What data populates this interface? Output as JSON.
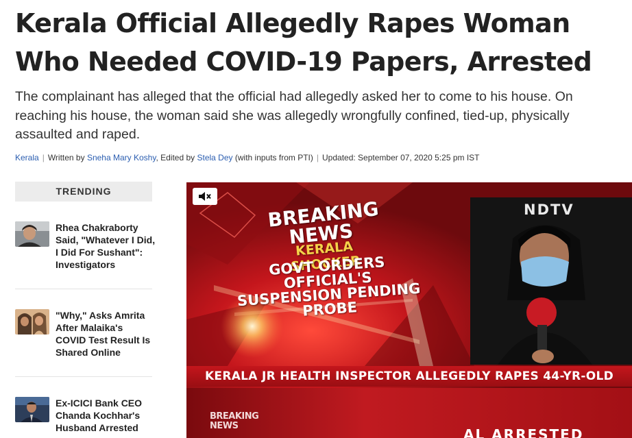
{
  "article": {
    "headline": "Kerala Official Allegedly Rapes Woman Who Needed COVID-19 Papers, Arrested",
    "summary": "The complainant has alleged that the official had allegedly asked her to come to his house. On reaching his house, the woman said she was allegedly wrongfully confined, tied-up, physically assaulted and raped.",
    "byline": {
      "category": "Kerala",
      "written_by_prefix": "Written by ",
      "author": "Sneha Mary Koshy",
      "edited_by_prefix": ", Edited by ",
      "editor": "Stela Dey",
      "inputs": " (with inputs from PTI)",
      "updated": "Updated: September 07, 2020 5:25 pm IST"
    }
  },
  "trending": {
    "header": "TRENDING",
    "items": [
      {
        "title": "Rhea Chakraborty Said, \"Whatever I Did, I Did For Sushant\": Investigators"
      },
      {
        "title": "\"Why,\" Asks Amrita After Malaika's COVID Test Result Is Shared Online"
      },
      {
        "title": "Ex-ICICI Bank CEO Chanda Kochhar's Husband Arrested"
      }
    ]
  },
  "video": {
    "mute_icon": "speaker-muted-icon",
    "breaking_line1": "BREAKING",
    "breaking_line2": "NEWS",
    "kerala_shocker": "KERALA SHOCKER",
    "headline_lines": [
      "GOVT ORDERS",
      "OFFICIAL'S",
      "SUSPENSION PENDING",
      "PROBE"
    ],
    "channel_logo": "NDTV",
    "ticker": "KERALA JR HEALTH INSPECTOR ALLEGEDLY RAPES 44-YR-OLD",
    "lower_brand_line1": "BREAKING",
    "lower_brand_line2": "NEWS",
    "lower_partial": "AL ARRESTED",
    "colors": {
      "red": "#b01217",
      "dark": "#111111",
      "yellow": "#f5d24a"
    }
  }
}
